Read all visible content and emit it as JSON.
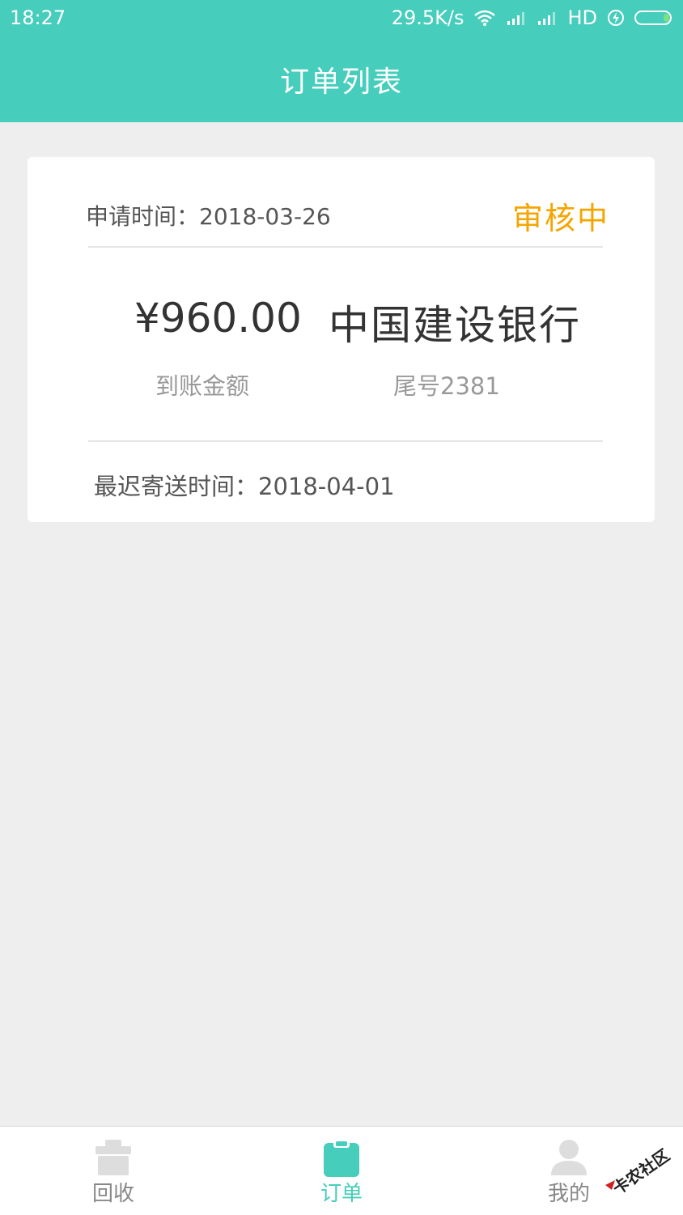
{
  "status_bar": {
    "time": "18:27",
    "speed": "29.5K/s",
    "network": "HD"
  },
  "header": {
    "title": "订单列表"
  },
  "order": {
    "apply_time": "申请时间：2018-03-26",
    "status": "审核中",
    "amount": "¥960.00",
    "amount_label": "到账金额",
    "bank_name": "中国建设银行",
    "tail_number": "尾号2381",
    "latest_ship_time": "最迟寄送时间：2018-04-01"
  },
  "tabs": [
    {
      "label": "回收",
      "icon": "gift-icon",
      "active": false
    },
    {
      "label": "订单",
      "icon": "clipboard-icon",
      "active": true
    },
    {
      "label": "我的",
      "icon": "user-icon",
      "active": false
    }
  ],
  "watermark": {
    "text": "卡农社区"
  },
  "colors": {
    "primary": "#46cdbb",
    "status_pending": "#f5a500",
    "background": "#eeeeee"
  }
}
